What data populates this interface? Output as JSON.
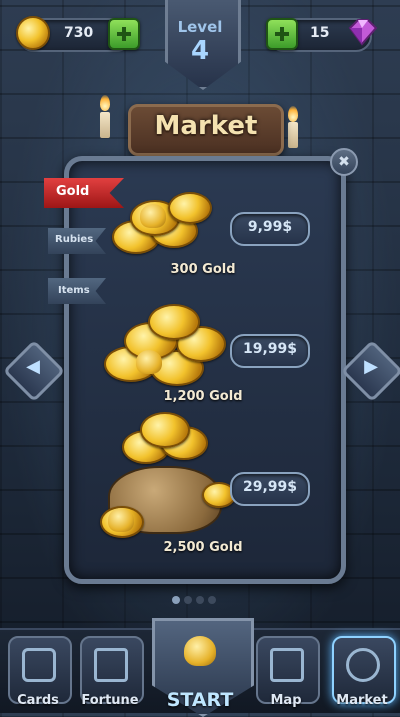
{
  "top_bar": {
    "gold_count": "730",
    "gem_count": "15",
    "level_label": "Level",
    "level_value": "4"
  },
  "title": "Market",
  "tabs": [
    {
      "label": "Gold",
      "active": true
    },
    {
      "label": "Rubies",
      "active": false
    },
    {
      "label": "Items",
      "active": false
    }
  ],
  "items": [
    {
      "label": "300 Gold",
      "price": "9,99$"
    },
    {
      "label": "1,200 Gold",
      "price": "19,99$"
    },
    {
      "label": "2,500 Gold",
      "price": "29,99$"
    }
  ],
  "close_symbol": "✖",
  "arrows": {
    "left": "◀",
    "right": "▶"
  },
  "pager": {
    "pages": 4,
    "active": 1
  },
  "nav": [
    {
      "label": "Cards"
    },
    {
      "label": "Fortune"
    },
    {
      "label": "START"
    },
    {
      "label": "Map"
    },
    {
      "label": "Market"
    }
  ],
  "colors": {
    "active_tab": "#c42a2a",
    "inactive_tab": "#3f5066",
    "gold": "#f2c22c",
    "start_label": "#bfe6ff"
  }
}
